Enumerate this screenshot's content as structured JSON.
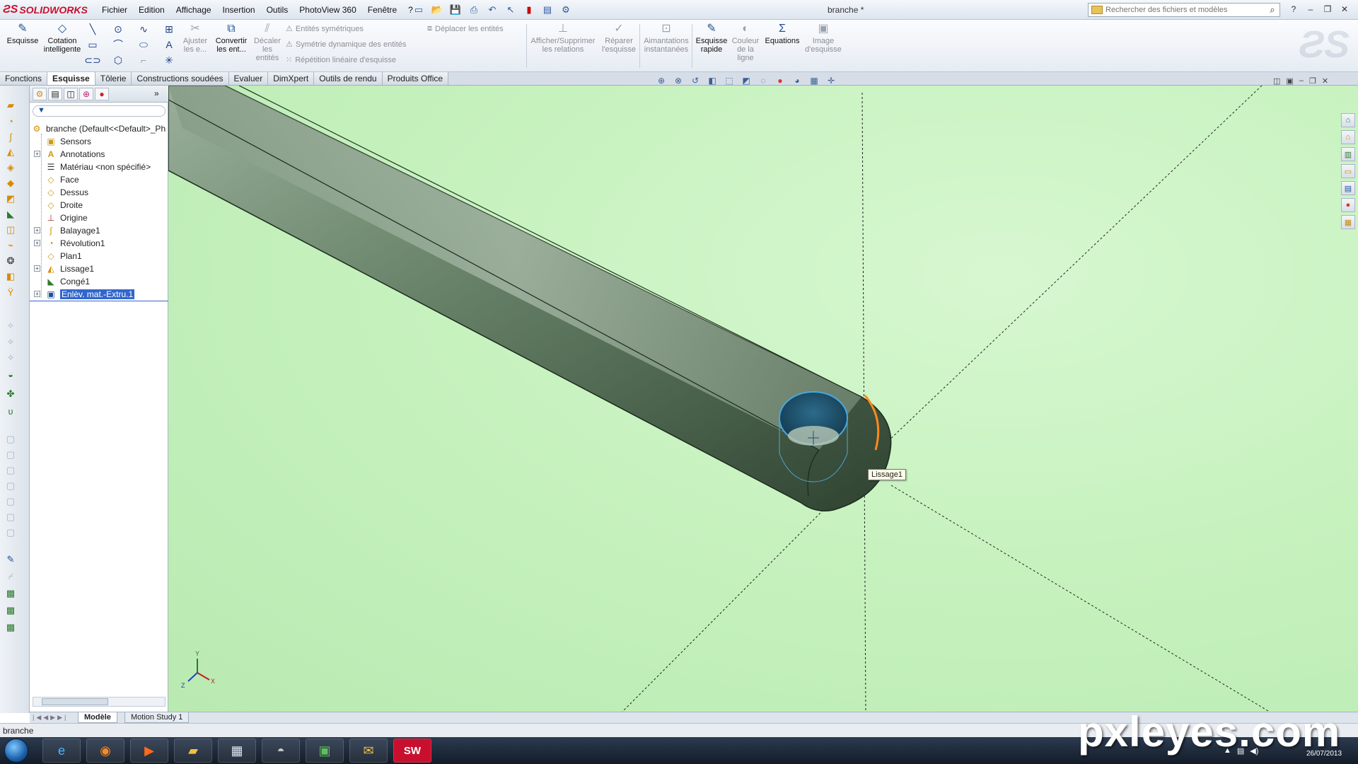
{
  "app": {
    "brand": "SOLIDWORKS",
    "document_title": "branche *",
    "menus": [
      "Fichier",
      "Edition",
      "Affichage",
      "Insertion",
      "Outils",
      "PhotoView 360",
      "Fenêtre",
      "?"
    ],
    "search_placeholder": "Rechercher des fichiers et modèles"
  },
  "ribbon": {
    "esquisse": "Esquisse",
    "cotation_1": "Cotation",
    "cotation_2": "intelligente",
    "ajuster_1": "Ajuster",
    "ajuster_2": "les e...",
    "convertir_1": "Convertir",
    "convertir_2": "les ent...",
    "decaler_1": "Décaler",
    "decaler_2": "les",
    "decaler_3": "entités",
    "entites_symetriques": "Entités symétriques",
    "symetrie_dynamique": "Symétrie dynamique des entités",
    "repetition_lineaire": "Répétition linéaire d'esquisse",
    "deplacer_entites": "Déplacer les entités",
    "afficher_relations_1": "Afficher/Supprimer",
    "afficher_relations_2": "les relations",
    "reparer_1": "Réparer",
    "reparer_2": "l'esquisse",
    "aimantations_1": "Aimantations",
    "aimantations_2": "instantanées",
    "esquisse_rapide_1": "Esquisse",
    "esquisse_rapide_2": "rapide",
    "couleur_1": "Couleur",
    "couleur_2": "de la",
    "couleur_3": "ligne",
    "equations": "Equations",
    "image_1": "Image",
    "image_2": "d'esquisse"
  },
  "tabs": [
    {
      "label": "Fonctions"
    },
    {
      "label": "Esquisse",
      "active": true
    },
    {
      "label": "Tôlerie"
    },
    {
      "label": "Constructions soudées"
    },
    {
      "label": "Evaluer"
    },
    {
      "label": "DimXpert"
    },
    {
      "label": "Outils de rendu"
    },
    {
      "label": "Produits Office"
    }
  ],
  "tree": {
    "root": "branche  (Default<<Default>_Ph",
    "items": [
      {
        "label": "Sensors",
        "icon": "sensor-icon",
        "expandable": false
      },
      {
        "label": "Annotations",
        "icon": "annotation-icon",
        "expandable": true
      },
      {
        "label": "Matériau <non spécifié>",
        "icon": "material-icon",
        "expandable": false
      },
      {
        "label": "Face",
        "icon": "plane-icon",
        "expandable": false
      },
      {
        "label": "Dessus",
        "icon": "plane-icon",
        "expandable": false
      },
      {
        "label": "Droite",
        "icon": "plane-icon",
        "expandable": false
      },
      {
        "label": "Origine",
        "icon": "origin-icon",
        "expandable": false
      },
      {
        "label": "Balayage1",
        "icon": "sweep-icon",
        "expandable": true
      },
      {
        "label": "Révolution1",
        "icon": "revolve-icon",
        "expandable": true
      },
      {
        "label": "Plan1",
        "icon": "plane-icon",
        "expandable": false
      },
      {
        "label": "Lissage1",
        "icon": "loft-icon",
        "expandable": true
      },
      {
        "label": "Congé1",
        "icon": "fillet-icon",
        "expandable": false
      },
      {
        "label": "Enlèv. mat.-Extru.1",
        "icon": "cut-extrude-icon",
        "expandable": true,
        "selected": true
      }
    ]
  },
  "viewport": {
    "tooltip": "Lissage1",
    "triad_labels": {
      "x": "X",
      "y": "Y",
      "z": "Z"
    }
  },
  "bottom_tabs": [
    {
      "label": "Modèle",
      "active": true
    },
    {
      "label": "Motion Study 1"
    }
  ],
  "status": {
    "text": "branche"
  },
  "taskbar": {
    "date": "26/07/2013"
  },
  "watermark": "pxleyes.com",
  "colors": {
    "viewport_bg": "#c7f2bf",
    "part_face": "#6f8a70",
    "selection_edge": "#ff8a1c",
    "hole_highlight": "#4aa8e0",
    "tree_selection": "#3366cc"
  }
}
